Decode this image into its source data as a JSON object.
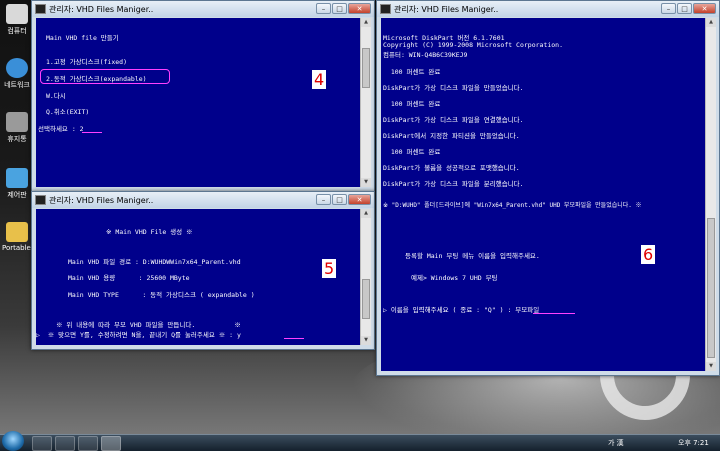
{
  "desktop": {
    "icons": [
      {
        "label": "컴퓨터",
        "color": "#d9d9d9"
      },
      {
        "label": "네트워크",
        "color": "#3a8fd8"
      },
      {
        "label": "휴지통",
        "color": "#9a9a9a"
      },
      {
        "label": "제어판",
        "color": "#4aa3e0"
      },
      {
        "label": "Portables",
        "color": "#e8c04a"
      }
    ]
  },
  "window4": {
    "title": "관리자:  VHD Files Maniger..",
    "lines": [
      "Main VHD file 만들기",
      "1.고정 가상디스크(fixed)",
      "2.동적 가상디스크(expandable)",
      "W.다시",
      "Q.취소(EXIT)",
      "선택하세요 : 2"
    ],
    "label": "4"
  },
  "window5": {
    "title": "관리자:  VHD Files Maniger..",
    "lines": [
      "※ Main VHD File 생성 ※",
      "Main VHD 파일 경로 : D:WUHDWWin7x64_Parent.vhd",
      "Main VHD 용량      : 25600 MByte",
      "Main VHD TYPE      : 동적 가상디스크 ( expandable )",
      "※ 위 내용에 따라 부모 VHD 파일을 만듭니다.          ※",
      "▷  ※ 맞으면 Y를, 수정하려면 N을, 끝내기 Q를 눌러주세요 ※ : y"
    ],
    "label": "5"
  },
  "window6": {
    "title": "관리자:  VHD Files Maniger..",
    "lines": [
      "Microsoft DiskPart 버전 6.1.7601",
      "Copyright (C) 1999-2008 Microsoft Corporation.",
      "컴퓨터: WIN-Q4B6C39KEJ9",
      "  100 퍼센트 완료",
      "DiskPart가 가상 디스크 파일을 만들었습니다.",
      "  100 퍼센트 완료",
      "DiskPart가 가상 디스크 파일을 연결했습니다.",
      "DiskPart에서 지정한 파티션을 만들었습니다.",
      "  100 퍼센트 완료",
      "DiskPart가 볼륨을 성공적으로 포맷했습니다.",
      "DiskPart가 가상 디스크 파일을 분리했습니다.",
      "※ \"D:WUHD\" 폴더[드라이브]에 \"Win7x64_Parent.vhd\" UHD 부모파일을 만들었습니다. ※",
      "등록할 Main 부팅 메뉴 이름을 입력해주세요.",
      "예제> Windows 7 UHD 부팅",
      "▷ 이름을 입력해주세요 ( 종료 : \"Q\" ) : 부모파일"
    ],
    "label": "6"
  },
  "taskbar": {
    "ime": "가 漢",
    "clock": "오후 7:21"
  }
}
